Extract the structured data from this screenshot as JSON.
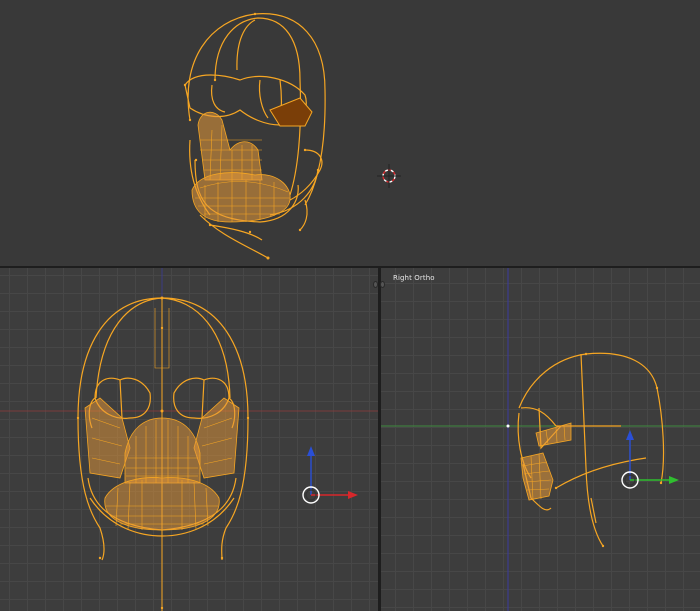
{
  "viewports": {
    "perspective": {
      "label": ""
    },
    "front": {
      "label": ""
    },
    "right": {
      "label": "Right Ortho"
    }
  },
  "colors": {
    "wire": "#f6a623",
    "wire_dark": "#c47a10",
    "face_fill": "#e79a3a",
    "axis_x": "#d8272b",
    "axis_y": "#2fbf2f",
    "axis_z": "#2a4fd6",
    "grid_line_red": "#8c3a3a",
    "grid_line_green": "#3e8c3e",
    "grid_line_blue": "#3a3aa0"
  },
  "icons": {
    "cursor": "3d-cursor-icon",
    "gizmo": "transform-gizmo-icon",
    "split": "area-split-icon"
  }
}
